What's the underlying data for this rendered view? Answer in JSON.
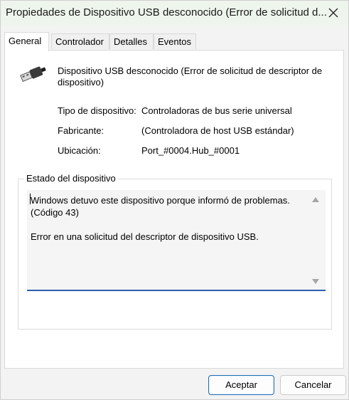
{
  "window": {
    "title": "Propiedades de Dispositivo USB desconocido (Error de solicitud d...",
    "close_glyph": "✕"
  },
  "tabs": [
    {
      "label": "General",
      "active": true
    },
    {
      "label": "Controlador",
      "active": false
    },
    {
      "label": "Detalles",
      "active": false
    },
    {
      "label": "Eventos",
      "active": false
    }
  ],
  "device": {
    "icon": "usb-plug-icon",
    "name": "Dispositivo USB desconocido (Error de solicitud de descriptor de dispositivo)"
  },
  "properties": [
    {
      "label": "Tipo de dispositivo:",
      "value": "Controladoras de bus serie universal"
    },
    {
      "label": "Fabricante:",
      "value": "(Controladora de host USB estándar)"
    },
    {
      "label": "Ubicación:",
      "value": "Port_#0004.Hub_#0001"
    }
  ],
  "status": {
    "group_label": "Estado del dispositivo",
    "text": "Windows detuvo este dispositivo porque informó de problemas.\n(Código 43)\n\nError en una solicitud del descriptor de dispositivo USB."
  },
  "buttons": {
    "ok_label": "Aceptar",
    "cancel_label": "Cancelar"
  },
  "colors": {
    "titlebar": "#eef5ec",
    "accent": "#2b5fad",
    "primary_border": "#1f6fb7"
  }
}
